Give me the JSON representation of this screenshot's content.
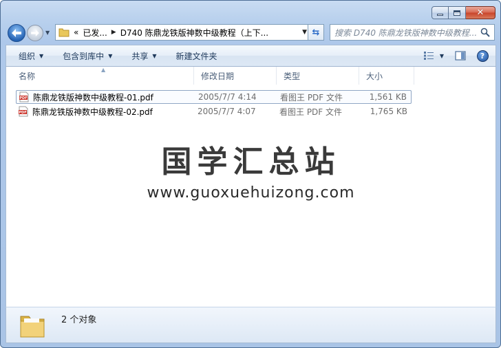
{
  "window": {
    "accent": "#b8d0ed",
    "caption_buttons": [
      "minimize",
      "maximize",
      "close"
    ]
  },
  "address": {
    "overflow": "«",
    "crumbs": [
      "已发...",
      "D740 陈鼎龙铁版神数中级教程（上下..."
    ]
  },
  "search": {
    "placeholder": "搜索 D740 陈鼎龙铁版神数中级教程..."
  },
  "toolbar": {
    "organize": "组织",
    "include_in_library": "包含到库中",
    "share": "共享",
    "new_folder": "新建文件夹"
  },
  "columns": {
    "name": "名称",
    "modified": "修改日期",
    "type": "类型",
    "size": "大小"
  },
  "files": [
    {
      "name": "陈鼎龙铁版神数中级教程-01.pdf",
      "modified": "2005/7/7 4:14",
      "type": "看图王 PDF 文件",
      "size": "1,561 KB",
      "icon": "pdf-icon"
    },
    {
      "name": "陈鼎龙铁版神数中级教程-02.pdf",
      "modified": "2005/7/7 4:07",
      "type": "看图王 PDF 文件",
      "size": "1,765 KB",
      "icon": "pdf-icon"
    }
  ],
  "watermark": {
    "title": "国学汇总站",
    "url": "www.guoxuehuizong.com"
  },
  "details": {
    "count": "2 个对象"
  }
}
